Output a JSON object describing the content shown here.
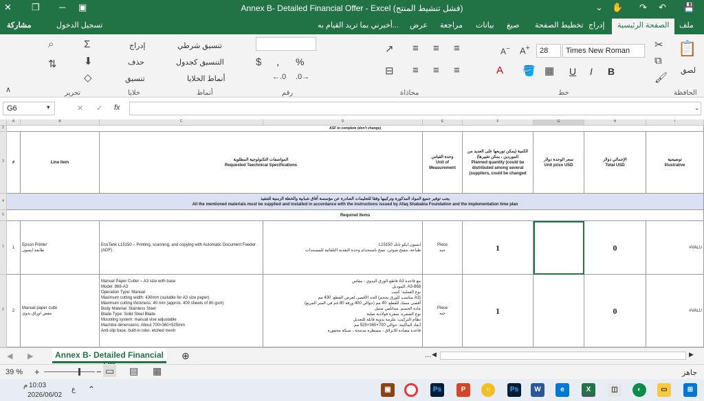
{
  "title_bar": {
    "title": "Annex B- Detailed Financial Offer  -  Excel (فشل تنشيط المنتج)",
    "minimize_label": "─",
    "restore_label": "❐",
    "close_label": "✕",
    "save_label": "💾",
    "undo_label": "↶",
    "redo_label": "↷",
    "touch_label": "✋",
    "qat_dropdown_label": "⌄",
    "ribbon_options_label": "▣"
  },
  "ribbon_tabs": {
    "file": "ملف",
    "home": "الصفحة الرئيسية",
    "insert": "إدراج",
    "layout": "تخطيط الصفحة",
    "formulas": "صيغ",
    "data": "بيانات",
    "review": "مراجعة",
    "view": "عرض",
    "tell_me": "أخبرني بما تريد القيام به...",
    "sign_in": "تسجيل الدخول",
    "share": "مشاركة"
  },
  "ribbon": {
    "font_name": "Times New Roman",
    "font_size": "28",
    "bold": "B",
    "italic": "I",
    "underline": "U",
    "paste_label": "لصق",
    "insert_label": "إدراج",
    "delete_label": "حذف",
    "format_label": "تنسيق",
    "conditional_label": "تنسيق شرطي",
    "as_table_label": "التنسيق كجدول",
    "cell_styles_label": "أنماط الخلايا",
    "percent": "%",
    "groups": {
      "clipboard": "الحافظة",
      "font": "خط",
      "alignment": "محاذاة",
      "number": "رقم",
      "styles": "أنماط",
      "cells": "خلايا",
      "editing": "تحرير"
    }
  },
  "formula_bar": {
    "cell_ref": "G6",
    "fx": "fx",
    "cancel": "✕",
    "enter": "✓"
  },
  "sheet": {
    "col_headers": [
      "A",
      "B",
      "C",
      "D",
      "E",
      "F",
      "G",
      "H",
      "I"
    ],
    "row_headers": [
      "2",
      "3",
      "4",
      "5",
      "1",
      "2"
    ],
    "banner": "ASF to complete (don't change)",
    "headers": {
      "num": "#",
      "line_item": "Line Item",
      "specs_ar": "المواصفات التكنولوجية المطلوبة",
      "specs_en": "Requested Taechnical Specifications",
      "unit_ar": "وحدة القياس",
      "unit_en": "Unit of Measurement",
      "qty_ar": "الكمية (يمكن توزيعها على العديد من الموردين ، يمكن تغييرها)",
      "qty_en": "Planned quantity (could be distributed among several (suppliers, could be changed",
      "price_ar": "سعر الوحدة دولار",
      "price_en": "Unit price USD",
      "total_ar": "الإجمالي دولار",
      "total_en": "Total USD",
      "illus_ar": "توضيحية",
      "illus_en": "Illustrative"
    },
    "note_ar": "يجب توفير جميع المواد المذكورة وتركيبها وفقا للتعليمات الصادرة عن مؤسسة آفاق شبابية والخطة الزمنية للتنفيذ",
    "note_en": "All the mentioned materials must be supplied and installed in accordance with the instructions issued by Afaq Shababia Foundation and the implementation time plan",
    "required_items": "Required Items",
    "rows": [
      {
        "num": "1",
        "item_en": "Epson Printer",
        "item_ar": "طابعة ابسون",
        "spec_en": "EcoTank L15150 – Printing, scanning, and copying with Automatic Document Feeder (ADF)",
        "spec_ar": "L15150 ابسون ايكو تانك\nطباعة، مسح ضوئي، نسخ باستخدام وحدة التغذية التلقائية للمستندات",
        "unit_en": "Piece",
        "unit_ar": "حبه",
        "qty": "1",
        "price": "",
        "total": "0",
        "illus": "#VALU"
      },
      {
        "num": "2",
        "item_en": "Manual paper cutte",
        "item_ar": "مقص اوراق يدوي",
        "spec_en": "Manual Paper Cutter – A3 size with base\nModel: 868-A3\nOperation Type: Manual\nMaximum cutting width: 430mm (suitable for A3 size paper)\nMaximum cutting thickness: 40 mm (approx. 400 sheets of 80 gsm)\nBody Material: Stainless Steel\nBlade Type: Solid Steel Blade\nMounting system: manual vise adjustable\nMachine dimensions: About 700×360×525mm\nAnti-slip base, built-in ruler, etched mesh",
        "spec_ar": "قاطع الورق اليدوي - مقاس A3 مع قاعدة\nالموديل: A3-868\nنوع العملية: كتيب\nالحد الأقصى لعرض القطع: 430 مم (مناسب للورق بحجم A3)\nأقصى سمك للقطع: 40 مم (حوالي 400 ورقة 80 غم في المتر المربع)\nمادة الجسم: ستانلس ستيل\nنوع الشفرة: شفرة فولاذية صلبة\nنظام التركيب: ملزمة يدوية قابلة للتعديل\nأبعاد الماكينة: حوالي 700×360×525 مم\nقاعدة مضادة للانزلاق ، مسطرة مدمجة ، شبكة محفورة",
        "unit_en": "Piece",
        "unit_ar": "حبه",
        "qty": "1",
        "price": "",
        "total": "0",
        "illus": "#VALU"
      }
    ]
  },
  "sheet_tabs": {
    "active": "Annex B- Detailed Financial Off",
    "add": "⊕",
    "prev": "◀",
    "next": "▶",
    "ellipsis": "..."
  },
  "status_bar": {
    "zoom": "39 %",
    "zoom_minus": "−",
    "zoom_plus": "+",
    "ready": "جاهز"
  },
  "taskbar": {
    "time": "10:03",
    "ampm": "م",
    "date": "2026/06/02",
    "lang": "ع"
  }
}
